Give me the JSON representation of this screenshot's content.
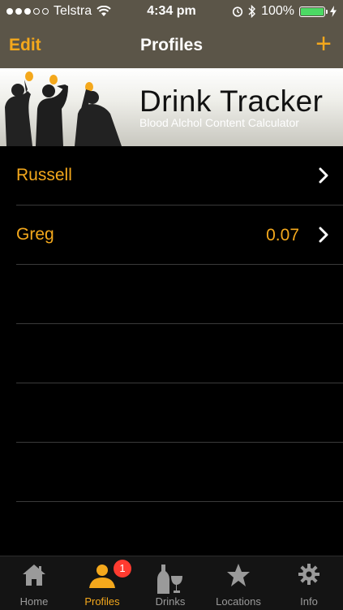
{
  "status": {
    "carrier": "Telstra",
    "time": "4:34 pm",
    "battery_percent": "100%",
    "battery_level": 1.0,
    "signal_bars": 3
  },
  "nav": {
    "edit_label": "Edit",
    "title": "Profiles",
    "add_label": "+"
  },
  "banner": {
    "title": "Drink Tracker",
    "subtitle": "Blood Alchol Content Calculator"
  },
  "profiles": [
    {
      "name": "Russell",
      "value": ""
    },
    {
      "name": "Greg",
      "value": "0.07"
    }
  ],
  "tabs": [
    {
      "label": "Home",
      "icon": "home-icon",
      "active": false
    },
    {
      "label": "Profiles",
      "icon": "person-icon",
      "active": true,
      "badge": "1"
    },
    {
      "label": "Drinks",
      "icon": "drinks-icon",
      "active": false
    },
    {
      "label": "Locations",
      "icon": "star-icon",
      "active": false
    },
    {
      "label": "Info",
      "icon": "gear-icon",
      "active": false
    }
  ],
  "colors": {
    "accent": "#f4a81c",
    "bar_background": "#5b5548",
    "badge": "#ff3b30",
    "battery": "#4cd964"
  }
}
